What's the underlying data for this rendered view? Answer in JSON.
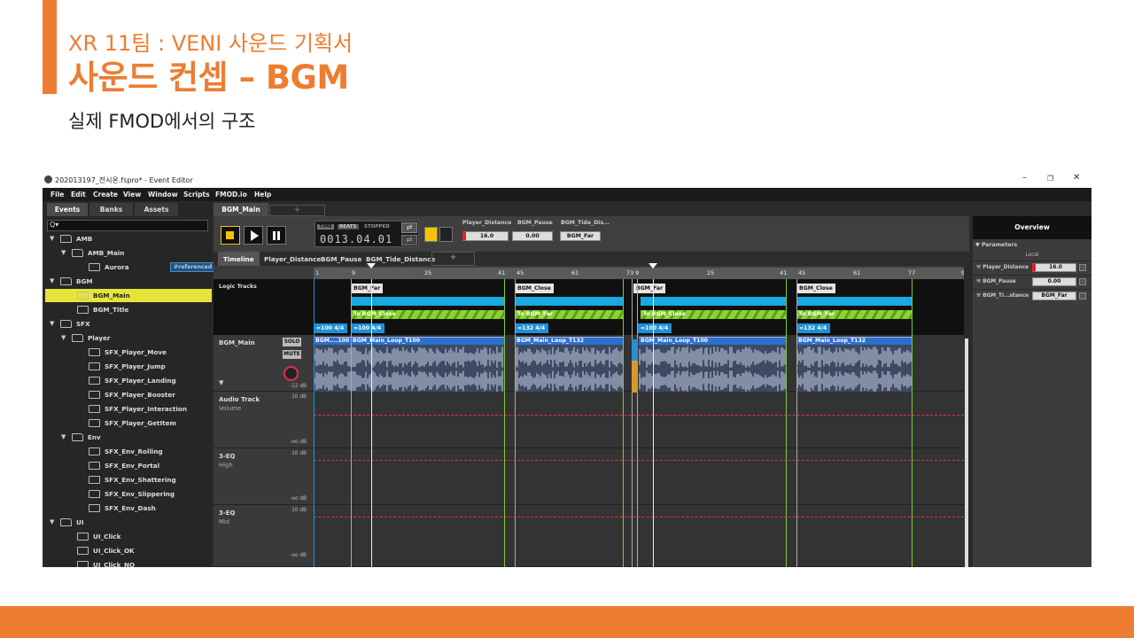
{
  "slide": {
    "subtitle": "XR 11팀 : VENI 사운드 기획서",
    "title": "사운드 컨셉 – BGM",
    "caption": "실제 FMOD에서의 구조",
    "accent_color": "#ed7d31"
  },
  "window": {
    "title": "202013197_전시온.fspro* - Event Editor",
    "controls": [
      "–",
      "❐",
      "✕"
    ]
  },
  "menu": [
    "File",
    "Edit",
    "Create",
    "View",
    "Window",
    "Scripts",
    "FMOD.io",
    "Help"
  ],
  "browser": {
    "tabs": [
      "Events",
      "Banks",
      "Assets"
    ],
    "search_icon": "Q▾",
    "tree": [
      {
        "label": "AMB",
        "type": "folder",
        "depth": 0,
        "open": true
      },
      {
        "label": "AMB_Main",
        "type": "folder",
        "depth": 1,
        "open": true
      },
      {
        "label": "Aurora",
        "type": "event",
        "depth": 2,
        "badge": "#referenced"
      },
      {
        "label": "BGM",
        "type": "folder",
        "depth": 0,
        "open": true
      },
      {
        "label": "BGM_Main",
        "type": "event",
        "depth": 1,
        "selected": true
      },
      {
        "label": "BGM_Title",
        "type": "event",
        "depth": 1
      },
      {
        "label": "SFX",
        "type": "folder",
        "depth": 0,
        "open": true
      },
      {
        "label": "Player",
        "type": "folder",
        "depth": 1,
        "open": true
      },
      {
        "label": "SFX_Player_Move",
        "type": "event",
        "depth": 2
      },
      {
        "label": "SFX_Player_Jump",
        "type": "event",
        "depth": 2
      },
      {
        "label": "SFX_Player_Landing",
        "type": "event",
        "depth": 2
      },
      {
        "label": "SFX_Player_Booster",
        "type": "event",
        "depth": 2
      },
      {
        "label": "SFX_Player_Interaction",
        "type": "event",
        "depth": 2
      },
      {
        "label": "SFX_Player_GetItem",
        "type": "event",
        "depth": 2
      },
      {
        "label": "Env",
        "type": "folder",
        "depth": 1,
        "open": true
      },
      {
        "label": "SFX_Env_Rolling",
        "type": "event",
        "depth": 2
      },
      {
        "label": "SFX_Env_Portal",
        "type": "event",
        "depth": 2
      },
      {
        "label": "SFX_Env_Shattering",
        "type": "event",
        "depth": 2
      },
      {
        "label": "SFX_Env_Slippering",
        "type": "event",
        "depth": 2
      },
      {
        "label": "SFX_Env_Dash",
        "type": "event",
        "depth": 2
      },
      {
        "label": "UI",
        "type": "folder",
        "depth": 0,
        "open": true
      },
      {
        "label": "UI_Click",
        "type": "event",
        "depth": 1
      },
      {
        "label": "UI_Click_OK",
        "type": "event",
        "depth": 1
      },
      {
        "label": "UI_Click_NO",
        "type": "event",
        "depth": 1
      }
    ]
  },
  "editor": {
    "event_tab": "BGM_Main",
    "add_tab": "+",
    "transport": {
      "mode_time": "TIME",
      "mode_beats": "BEATS",
      "state": "STOPPED",
      "position": "0013.04.01",
      "loop_icon": "⇄",
      "metronome_icon": "⇄"
    },
    "params": [
      {
        "name": "Player_Distance",
        "value": "16.0"
      },
      {
        "name": "BGM_Pause",
        "value": "0.00"
      },
      {
        "name": "BGM_Tide_Dis...",
        "value": "BGM_Far"
      }
    ],
    "sheet_tabs": [
      "Timeline",
      "Player_Distance",
      "BGM_Pause",
      "BGM_Tide_Distance",
      "+"
    ],
    "ruler": [
      "1",
      "9",
      "25",
      "41",
      "45",
      "61",
      "73",
      "9",
      "25",
      "41",
      "45",
      "61",
      "77",
      "9"
    ],
    "logic_label": "Logic Tracks",
    "destinations": [
      "BGM_Far",
      "BGM_Close",
      "BGM_Far",
      "BGM_Close"
    ],
    "transitions": [
      "To BGM_Close",
      "To BGM_Far",
      "To BGM_Close",
      "To BGM_Far"
    ],
    "tempos": [
      "=100 4/4",
      "=100 4/4",
      "=132 4/4",
      "=100 4/4",
      "=132 4/4"
    ],
    "tracks": [
      {
        "name": "BGM_Main",
        "solo": "SOLO",
        "mute": "MUTE",
        "gain": "-12 dB"
      },
      {
        "name": "Audio Track",
        "sub": "Volume",
        "top": "10 dB",
        "bottom": "-oo dB"
      },
      {
        "name": "3-EQ",
        "sub": "High",
        "top": "10 dB",
        "bottom": "-oo dB"
      },
      {
        "name": "3-EQ",
        "sub": "Mid",
        "top": "10 dB",
        "bottom": "-oo dB"
      }
    ],
    "clips": [
      "BGM....100",
      "BGM_Main_Loop_T100",
      "BGM_Main_Loop_T132",
      "BGM_Main_Loop_T100",
      "BGM_Main_Loop_T132"
    ]
  },
  "overview": {
    "header": "Overview",
    "section": "Parameters",
    "scope": "Local",
    "params": [
      {
        "name": "Player_Distance",
        "value": "16.0"
      },
      {
        "name": "BGM_Pause",
        "value": "0.00"
      },
      {
        "name": "BGM_Ti...stance",
        "value": "BGM_Far"
      }
    ]
  }
}
